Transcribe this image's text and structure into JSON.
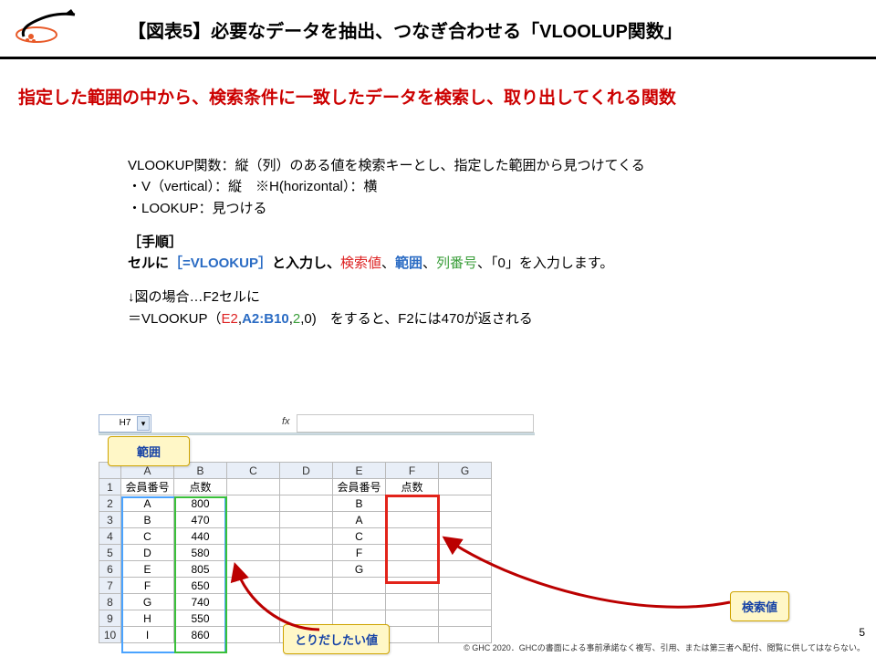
{
  "title": "【図表5】必要なデータを抽出、つなぎ合わせる「VLOOLUP関数」",
  "subtitle": "指定した範囲の中から、検索条件に一致したデータを検索し、取り出してくれる関数",
  "body": {
    "line1": "VLOOKUP関数：縦（列）のある値を検索キーとし、指定した範囲から見つけてくる",
    "line2": "・V（vertical）：縦　※H(horizontal）：横",
    "line3": "・LOOKUP：見つける",
    "proc_label": "［手順］",
    "proc_line_a": "セルに",
    "proc_formula": "［=VLOOKUP］",
    "proc_line_b": "と入力し、",
    "arg1": "検索値",
    "sep": "、",
    "arg2": "範囲",
    "arg3": "列番号",
    "proc_line_c": "、「0」を入力します。",
    "ex1": "↓図の場合…F2セルに",
    "ex2_a": "＝VLOOKUP（",
    "ex2_e2": "E2",
    "ex2_c1": ",",
    "ex2_rng": "A2:B10",
    "ex2_c2": ",",
    "ex2_col": "2",
    "ex2_b": ",0)　をすると、F2には470が返される"
  },
  "sheet": {
    "name_box": "H7",
    "fx": "fx",
    "cols": [
      "",
      "A",
      "B",
      "C",
      "D",
      "E",
      "F",
      "G"
    ],
    "header_row": [
      "1",
      "会員番号",
      "点数",
      "",
      "",
      "会員番号",
      "点数",
      ""
    ],
    "rows": [
      [
        "2",
        "A",
        "800",
        "",
        "",
        "B",
        "",
        ""
      ],
      [
        "3",
        "B",
        "470",
        "",
        "",
        "A",
        "",
        ""
      ],
      [
        "4",
        "C",
        "440",
        "",
        "",
        "C",
        "",
        ""
      ],
      [
        "5",
        "D",
        "580",
        "",
        "",
        "F",
        "",
        ""
      ],
      [
        "6",
        "E",
        "805",
        "",
        "",
        "G",
        "",
        ""
      ],
      [
        "7",
        "F",
        "650",
        "",
        "",
        "",
        "",
        ""
      ],
      [
        "8",
        "G",
        "740",
        "",
        "",
        "",
        "",
        ""
      ],
      [
        "9",
        "H",
        "550",
        "",
        "",
        "",
        "",
        ""
      ],
      [
        "10",
        "I",
        "860",
        "",
        "",
        "",
        "",
        ""
      ]
    ]
  },
  "callouts": {
    "range": "範囲",
    "want": "とりだしたい値",
    "lookup": "検索値"
  },
  "page_number": "5",
  "footer": "© GHC 2020．GHCの書面による事前承諾なく複写、引用、または第三者へ配付、閲覧に供してはならない。"
}
